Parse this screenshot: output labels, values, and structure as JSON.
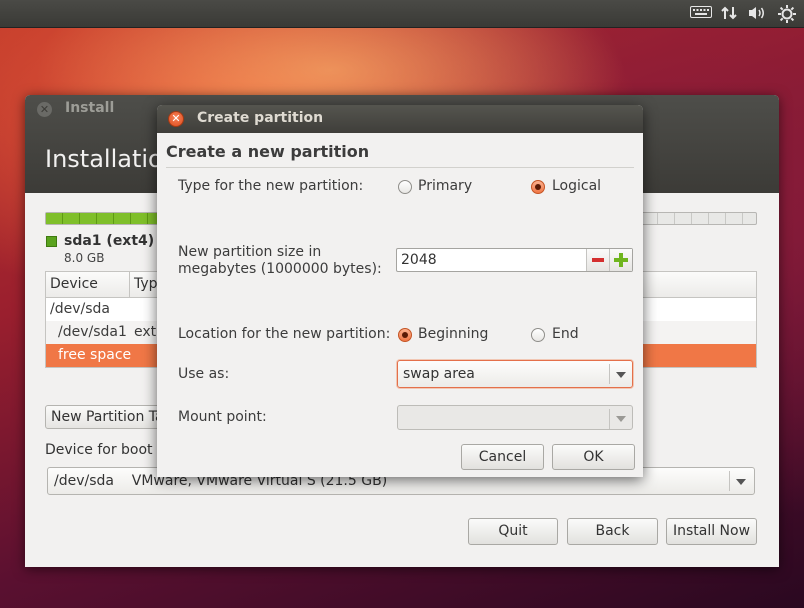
{
  "panel": {
    "icons": [
      "keyboard-icon",
      "network-icon",
      "volume-icon",
      "settings-gear-icon"
    ]
  },
  "installer": {
    "window_title": "Install",
    "heading": "Installatio",
    "legend": {
      "label": "sda1 (ext4)",
      "size": "8.0 GB",
      "color": "#5aa31e"
    },
    "progress_fraction": 0.7,
    "table": {
      "columns": [
        "Device",
        "Typ"
      ],
      "rows": [
        {
          "device": "/dev/sda",
          "type": ""
        },
        {
          "device": "/dev/sda1",
          "type": "ext"
        },
        {
          "device": "free space",
          "type": ""
        }
      ],
      "selected_row": 2
    },
    "new_partition_table_label": "New Partition Ta",
    "boot_loader_label": "Device for boot l",
    "boot_loader_value": "/dev/sda    VMware, VMware Virtual S (21.5 GB)",
    "buttons": {
      "quit": "Quit",
      "back": "Back",
      "install_now": "Install Now"
    }
  },
  "dialog": {
    "title": "Create partition",
    "heading": "Create a new partition",
    "type_label": "Type for the new partition:",
    "type_options": {
      "primary": "Primary",
      "logical": "Logical"
    },
    "type_selected": "logical",
    "size_label": "New partition size in megabytes (1000000 bytes):",
    "size_value": "2048",
    "location_label": "Location for the new partition:",
    "location_options": {
      "beginning": "Beginning",
      "end": "End"
    },
    "location_selected": "beginning",
    "use_as_label": "Use as:",
    "use_as_value": "swap area",
    "mount_point_label": "Mount point:",
    "mount_point_value": "",
    "buttons": {
      "cancel": "Cancel",
      "ok": "OK"
    }
  },
  "colors": {
    "accent_orange": "#f07746",
    "titlebar_dark": "#3c3b37",
    "progress_green": "#7fbf2a"
  }
}
